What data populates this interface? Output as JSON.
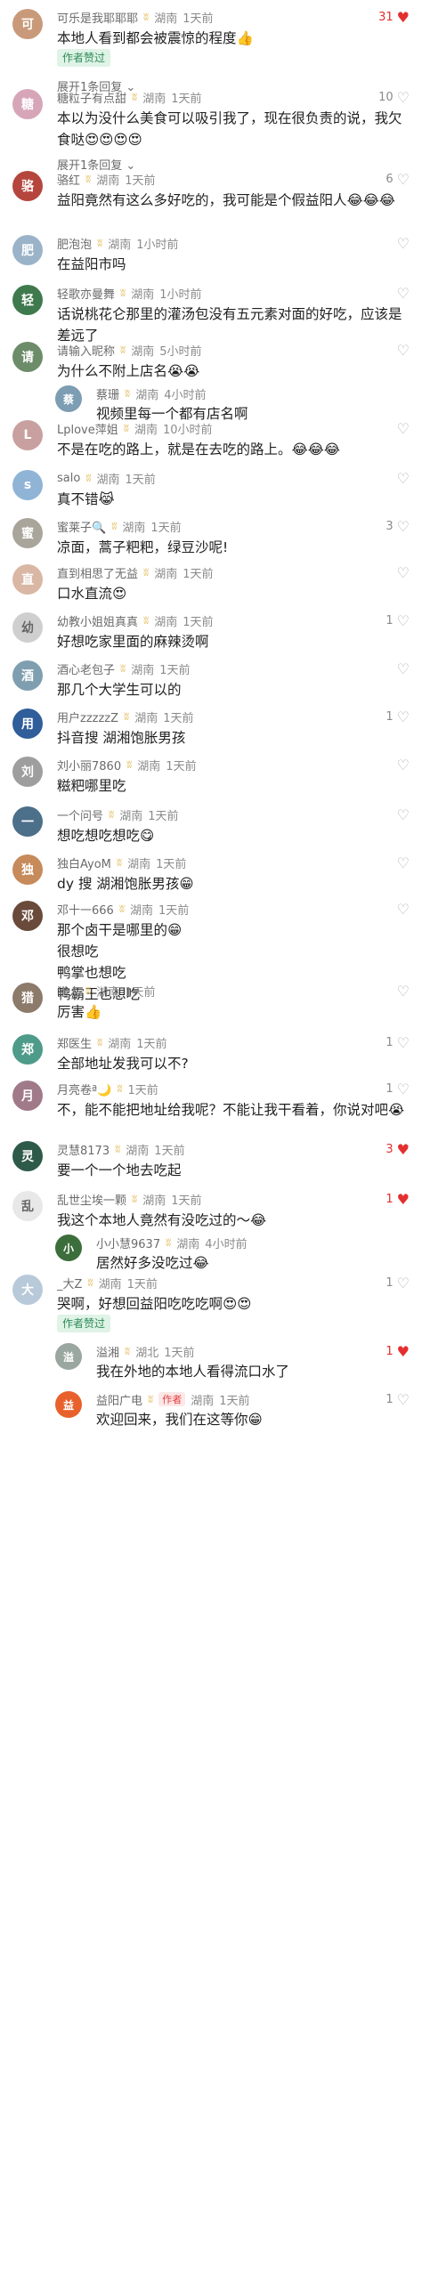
{
  "comments": [
    {
      "user": "可乐是我耶耶耶",
      "loc": "湖南",
      "time": "1天前",
      "text": "本地人看到都会被震惊的程度👍",
      "likes": "31",
      "liked": true,
      "author_tag": "作者赞过",
      "expand": "展开1条回复",
      "av_color": "#c99a7a",
      "av_char": "可"
    },
    {
      "user": "糖粒子有点甜",
      "loc": "湖南",
      "time": "1天前",
      "text": "本以为没什么美食可以吸引我了，现在很负责的说，我欠食哒😍😍😍😍",
      "likes": "10",
      "liked": false,
      "expand": "展开1条回复",
      "av_color": "#d6a6b8",
      "av_char": "糖"
    },
    {
      "user": "骆红",
      "loc": "湖南",
      "time": "1天前",
      "text": "益阳竟然有这么多好吃的，我可能是个假益阳人😂😂😂",
      "likes": "6",
      "liked": false,
      "av_color": "#b5463d",
      "av_char": "骆"
    },
    {
      "user": "肥泡泡",
      "loc": "湖南",
      "time": "1小时前",
      "text": "在益阳市吗",
      "likes": "",
      "liked": false,
      "av_color": "#9bb3c9",
      "av_char": "肥"
    },
    {
      "user": "轻歌亦曼舞",
      "loc": "湖南",
      "time": "1小时前",
      "text": "话说桃花仑那里的灌汤包没有五元素对面的好吃，应该是差远了",
      "likes": "",
      "liked": false,
      "av_color": "#3f7a4f",
      "av_char": "轻"
    },
    {
      "user": "请输入昵称",
      "loc": "湖南",
      "time": "5小时前",
      "text": "为什么不附上店名😭😭",
      "likes": "",
      "liked": false,
      "av_color": "#6d8c6a",
      "av_char": "请",
      "reply": {
        "user": "蔡珊",
        "loc": "湖南",
        "time": "4小时前",
        "text": "视频里每一个都有店名啊",
        "av_color": "#7d9db3",
        "av_char": "蔡"
      }
    },
    {
      "user": "Lplove萍姐",
      "loc": "湖南",
      "time": "10小时前",
      "text": "不是在吃的路上，就是在去吃的路上。😂😂😂",
      "likes": "",
      "liked": false,
      "av_color": "#c9a0a0",
      "av_char": "L"
    },
    {
      "user": "salo",
      "loc": "湖南",
      "time": "1天前",
      "text": "真不错😹",
      "likes": "",
      "liked": false,
      "av_color": "#8fb4d6",
      "av_char": "s"
    },
    {
      "user": "蜜莱子🔍",
      "loc": "湖南",
      "time": "1天前",
      "text": "凉面，蒿子粑粑，绿豆沙呢!",
      "likes": "3",
      "liked": false,
      "av_color": "#a9a59b",
      "av_char": "蜜"
    },
    {
      "user": "直到相思了无益",
      "loc": "湖南",
      "time": "1天前",
      "text": "口水直流😍",
      "likes": "",
      "liked": false,
      "av_color": "#d9b7a4",
      "av_char": "直"
    },
    {
      "user": "幼教小姐姐真真",
      "loc": "湖南",
      "time": "1天前",
      "text": "好想吃家里面的麻辣烫啊",
      "likes": "1",
      "liked": false,
      "av_color": "#cfcfcf",
      "av_char": "幼"
    },
    {
      "user": "酒心老包子",
      "loc": "湖南",
      "time": "1天前",
      "text": "那几个大学生可以的",
      "likes": "",
      "liked": false,
      "av_color": "#7f9fb0",
      "av_char": "酒"
    },
    {
      "user": "用户zzzzzZ",
      "loc": "湖南",
      "time": "1天前",
      "text": "抖音搜 湖湘饱胀男孩",
      "likes": "1",
      "liked": false,
      "av_color": "#2f5e9a",
      "av_char": "用"
    },
    {
      "user": "刘小丽7860",
      "loc": "湖南",
      "time": "1天前",
      "text": "糍粑哪里吃",
      "likes": "",
      "liked": false,
      "av_color": "#9e9e9e",
      "av_char": "刘"
    },
    {
      "user": "一个问号",
      "loc": "湖南",
      "time": "1天前",
      "text": "想吃想吃想吃😋",
      "likes": "",
      "liked": false,
      "av_color": "#4c6f8a",
      "av_char": "一"
    },
    {
      "user": "独白AyoM",
      "loc": "湖南",
      "time": "1天前",
      "text": "dy 搜 湖湘饱胀男孩😁",
      "likes": "",
      "liked": false,
      "av_color": "#c78a5a",
      "av_char": "独"
    },
    {
      "user": "邓十一666",
      "loc": "湖南",
      "time": "1天前",
      "text": "那个卤干是哪里的😁\n很想吃\n鸭掌也想吃\n鸭霸王也想吃",
      "likes": "",
      "liked": false,
      "av_color": "#6a4a3a",
      "av_char": "邓"
    },
    {
      "user": "猎人",
      "loc": "湖南",
      "time": "1天前",
      "text": "厉害👍",
      "likes": "",
      "liked": false,
      "av_color": "#8c7a6a",
      "av_char": "猎"
    },
    {
      "user": "郑医生",
      "loc": "湖南",
      "time": "1天前",
      "text": "全部地址发我可以不?",
      "likes": "1",
      "liked": false,
      "av_color": "#4f9b8a",
      "av_char": "郑"
    },
    {
      "user": "月亮卷ª🌙",
      "loc": "",
      "time": "1天前",
      "text": "不，能不能把地址给我呢？不能让我干看着，你说对吧😭",
      "likes": "1",
      "liked": false,
      "av_color": "#a07a88",
      "av_char": "月"
    },
    {
      "user": "灵慧8173",
      "loc": "湖南",
      "time": "1天前",
      "text": "要一个一个地去吃起",
      "likes": "3",
      "liked": true,
      "av_color": "#2e5a4a",
      "av_char": "灵"
    },
    {
      "user": "乱世尘埃一颗",
      "loc": "湖南",
      "time": "1天前",
      "text": "我这个本地人竟然有没吃过的～😂",
      "likes": "1",
      "liked": true,
      "av_color": "#e8e8e8",
      "av_char": "乱",
      "reply": {
        "user": "小小慧9637",
        "loc": "湖南",
        "time": "4小时前",
        "text": "居然好多没吃过😂",
        "av_color": "#3c6e3c",
        "av_char": "小"
      }
    },
    {
      "user": "_大Z",
      "loc": "湖南",
      "time": "1天前",
      "text": "哭啊，好想回益阳吃吃吃啊😍😍",
      "likes": "1",
      "liked": false,
      "author_tag": "作者赞过",
      "av_color": "#b8c9d9",
      "av_char": "大",
      "replies": [
        {
          "user": "溢湘",
          "loc": "湖北",
          "time": "1天前",
          "text": "我在外地的本地人看得流口水了",
          "likes": "1",
          "liked": true,
          "av_color": "#9aa7a0",
          "av_char": "溢"
        },
        {
          "user": "益阳广电",
          "tag": "作者",
          "loc": "湖南",
          "time": "1天前",
          "text": "欢迎回来，我们在这等你😁",
          "likes": "1",
          "liked": false,
          "av_color": "#e8612c",
          "av_char": "益"
        }
      ]
    }
  ]
}
